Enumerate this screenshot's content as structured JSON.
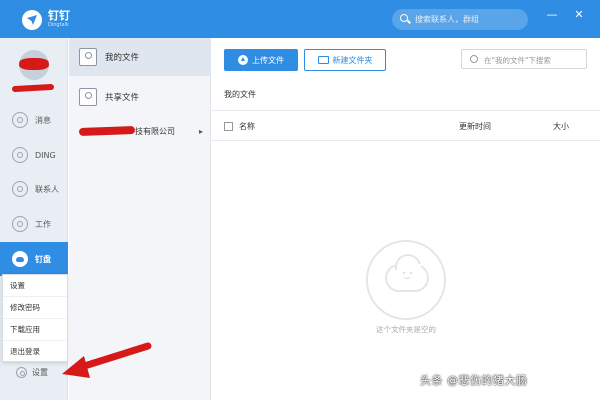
{
  "titlebar": {
    "app_name": "钉钉",
    "app_sub": "Dingtalk",
    "search_placeholder": "搜索联系人，群组",
    "minimize": "—",
    "close": "✕"
  },
  "nav": {
    "items": [
      {
        "label": "消息",
        "icon": "message-icon"
      },
      {
        "label": "DING",
        "icon": "ding-icon"
      },
      {
        "label": "联系人",
        "icon": "contacts-icon"
      },
      {
        "label": "工作",
        "icon": "work-icon"
      },
      {
        "label": "钉盘",
        "icon": "cloud-disk-icon",
        "active": true
      }
    ],
    "popup_menu": [
      "设置",
      "修改密码",
      "下载应用",
      "退出登录"
    ],
    "settings_label": "设置"
  },
  "col2": {
    "items": [
      {
        "label": "我的文件",
        "selected": true
      },
      {
        "label": "共享文件"
      }
    ],
    "org_suffix": "技有限公司",
    "org_chevron": "▸"
  },
  "main": {
    "upload_label": "上传文件",
    "new_folder_label": "新建文件夹",
    "search_placeholder": "在\"我的文件\"下搜索",
    "breadcrumb": "我的文件",
    "columns": {
      "name": "名称",
      "time": "更新时间",
      "size": "大小"
    },
    "empty_text": "这个文件夹是空的"
  },
  "watermark": "头条 @悲伤的猪大肠",
  "colors": {
    "accent": "#2f8de4",
    "annotation_red": "#d61a1a"
  }
}
